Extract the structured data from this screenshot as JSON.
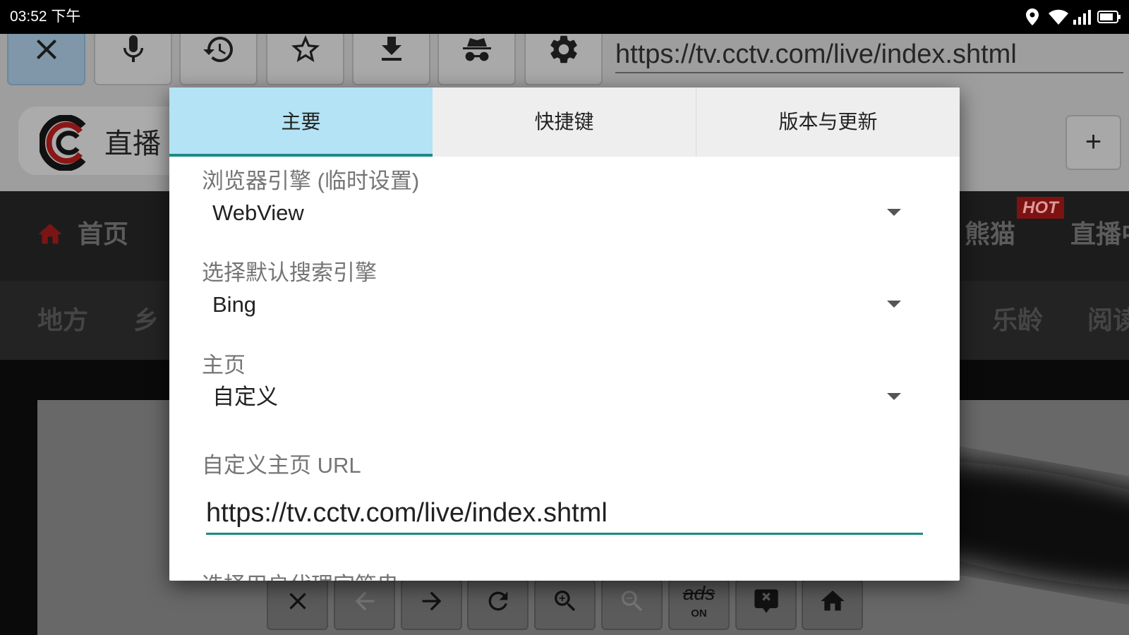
{
  "status_bar": {
    "time": "03:52 下午",
    "icons": [
      "location-icon",
      "wifi-icon",
      "signal-icon",
      "battery-icon"
    ]
  },
  "toolbar": {
    "buttons": [
      {
        "icon": "close-icon",
        "active": true
      },
      {
        "icon": "mic-icon"
      },
      {
        "icon": "history-icon"
      },
      {
        "icon": "star-outline-icon"
      },
      {
        "icon": "download-icon"
      },
      {
        "icon": "incognito-icon"
      },
      {
        "icon": "gear-icon"
      }
    ],
    "url": "https://tv.cctv.com/live/index.shtml"
  },
  "tab_strip": {
    "tab_icon": "cctv-logo",
    "tab_title": "直播",
    "new_tab_label": "+"
  },
  "web_page": {
    "nav_primary": [
      {
        "label": "首页",
        "icon": "home-icon"
      },
      {
        "label": "熊猫",
        "badge": "HOT"
      },
      {
        "label": "直播中"
      }
    ],
    "nav_secondary": [
      "地方",
      "乡",
      "乐龄",
      "阅读"
    ]
  },
  "bottom_bar": {
    "buttons": [
      {
        "icon": "close-icon"
      },
      {
        "icon": "arrow-back-icon",
        "enabled": false
      },
      {
        "icon": "arrow-forward-icon"
      },
      {
        "icon": "refresh-icon"
      },
      {
        "icon": "zoom-in-icon"
      },
      {
        "icon": "zoom-out-icon",
        "enabled": false
      },
      {
        "label": "ads",
        "state": "ON"
      },
      {
        "icon": "close-bubble-icon"
      },
      {
        "icon": "home-icon"
      }
    ]
  },
  "settings_dialog": {
    "tabs": [
      {
        "label": "主要",
        "active": true
      },
      {
        "label": "快捷键",
        "active": false
      },
      {
        "label": "版本与更新",
        "active": false
      }
    ],
    "fields": [
      {
        "label": "浏览器引擎 (临时设置)",
        "value": "WebView"
      },
      {
        "label": "选择默认搜索引擎",
        "value": "Bing"
      },
      {
        "label": "主页",
        "value": "自定义"
      },
      {
        "label": "自定义主页 URL",
        "value": "https://tv.cctv.com/live/index.shtml"
      },
      {
        "label": "选择用户代理字符串"
      }
    ]
  },
  "colors": {
    "accent": "#1a8c82",
    "active_tab": "#b3e3f4",
    "inactive_tab": "#eeeeee",
    "label_text": "#757575",
    "value_text": "#212121"
  }
}
